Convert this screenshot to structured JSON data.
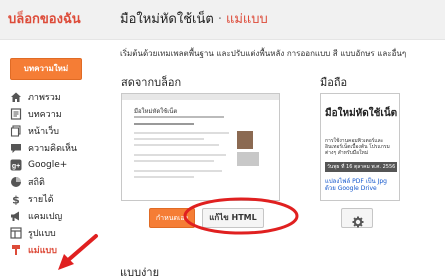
{
  "header": {
    "blog_list_label": "บล็อกของฉัน",
    "blog_name": "มือใหม่หัดใช้เน็ต",
    "separator": "·",
    "section": "แม่แบบ"
  },
  "sidebar": {
    "new_post_label": "บทความใหม่",
    "items": [
      {
        "label": "ภาพรวม",
        "icon": "home-icon"
      },
      {
        "label": "บทความ",
        "icon": "posts-icon"
      },
      {
        "label": "หน้าเว็บ",
        "icon": "pages-icon"
      },
      {
        "label": "ความคิดเห็น",
        "icon": "comments-icon"
      },
      {
        "label": "Google+",
        "icon": "google-plus-icon"
      },
      {
        "label": "สถิติ",
        "icon": "stats-icon"
      },
      {
        "label": "รายได้",
        "icon": "earnings-icon"
      },
      {
        "label": "แคมเปญ",
        "icon": "campaigns-icon"
      },
      {
        "label": "รูปแบบ",
        "icon": "layout-icon"
      },
      {
        "label": "แม่แบบ",
        "icon": "template-icon",
        "active": true
      }
    ]
  },
  "main": {
    "intro": "เริ่มต้นด้วยเทมเพลตพื้นฐาน และปรับแต่งพื้นหลัง การออกแบบ สี แบบอักษร และอื่นๆ",
    "live_label": "สดจากบล็อก",
    "mobile_label": "มือถือ",
    "simple_label": "แบบง่าย",
    "live_preview": {
      "title": "มือใหม่หัดใช้เน็ต"
    },
    "mobile_preview": {
      "title": "มือใหม่หัดใช้เน็ต",
      "text": "การใช้งานคอมพิวเตอร์และอินเทอร์เน็ตเบื้องต้น โปรแกรมต่างๆ สำหรับมือใหม่",
      "date": "วันพุธ ที่ 16 ตุลาคม พ.ศ. 2556",
      "link": "แปลงไฟล์ PDF เป็น Jpg ด้วย Google Drive"
    },
    "customize_label": "กำหนดเอง",
    "edit_html_label": "แก้ไข HTML"
  },
  "colors": {
    "accent": "#dd4b39",
    "button_orange": "#f57d35",
    "highlight_red": "#e02020"
  }
}
